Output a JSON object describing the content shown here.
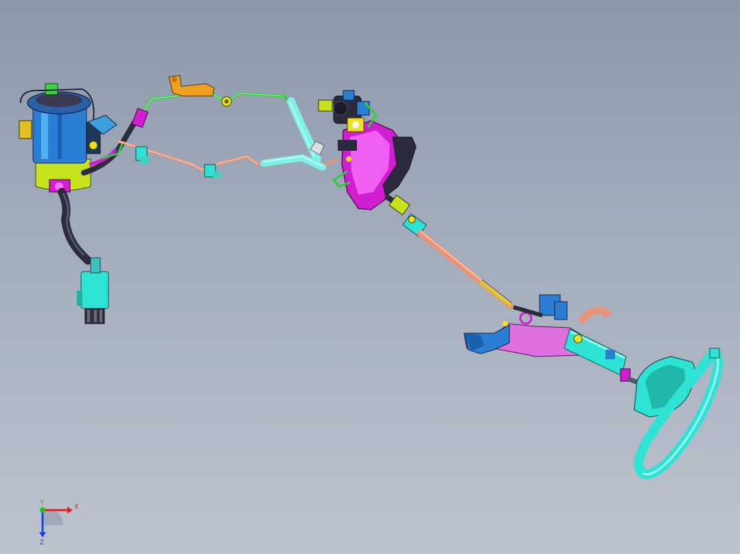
{
  "viewport": {
    "background_top": "#8c98aa",
    "background_bottom": "#bcc3ce"
  },
  "triad": {
    "x_label": "X",
    "y_label": "Y",
    "z_label": "Z",
    "x_color": "#e02020",
    "y_color": "#20c020",
    "z_color": "#2040e0"
  },
  "assembly": {
    "parts": [
      "fuel-pump-module-icon",
      "fuel-filter-icon",
      "fuel-line-icon",
      "brake-line-icon",
      "steering-gear-icon",
      "intermediate-shaft-icon",
      "steering-column-icon",
      "steering-wheel-icon",
      "pedal-bracket-icon"
    ],
    "colors": {
      "pump_blue": "#2a7fd4",
      "pump_yellow": "#c6e21c",
      "magenta": "#d21ed2",
      "cyan": "#2ee3d4",
      "salmon": "#e89478",
      "green": "#2ecc40",
      "orange": "#f0a020",
      "dark": "#2b2b3c"
    }
  }
}
